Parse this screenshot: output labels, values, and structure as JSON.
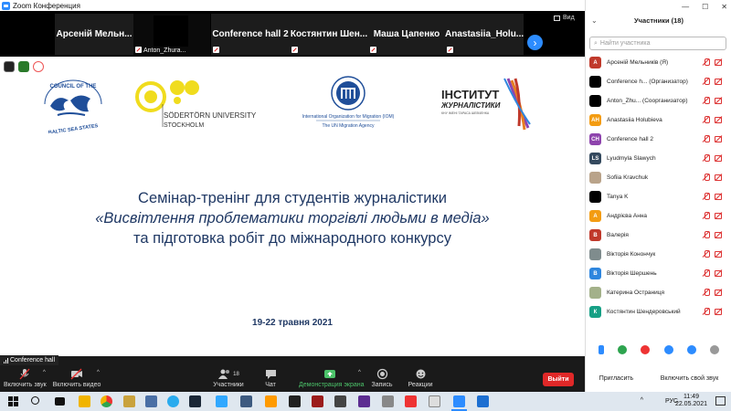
{
  "window": {
    "title": "Zoom Конференция"
  },
  "strip": {
    "tiles": [
      {
        "name": "Арсеній Мельн...",
        "type": "name"
      },
      {
        "name": "Anton_Zhura...",
        "type": "video"
      },
      {
        "name": "Conference hall 2",
        "type": "name"
      },
      {
        "name": "Костянтин Шен...",
        "type": "name"
      },
      {
        "name": "Маша Цапенко",
        "type": "name"
      },
      {
        "name": "Anastasiia_Holu...",
        "type": "name"
      }
    ],
    "view_label": "Вид"
  },
  "share": {
    "logos": {
      "cbss": "COUNCIL OF THE BALTIC SEA STATES",
      "sodertorn_line1": "SÖDERTÖRN UNIVERSITY",
      "sodertorn_line2": "STOCKHOLM",
      "iom_line1": "International Organization for Migration (IOM)",
      "iom_line2": "The UN Migration Agency",
      "inst_line1": "ІНСТИТУТ",
      "inst_line2": "ЖУРНАЛІСТИКИ",
      "inst_line3": "КНУ ІМЕНІ ТАРАСА ШЕВЧЕНКА"
    },
    "headline_line1": "Семінар-тренінг для студентів журналістики",
    "headline_line2": "«Висвітлення проблематики торгівлі людьми в медіа»",
    "headline_line3": "та підготовка робіт до міжнародного конкурсу",
    "dates": "19-22 травня 2021",
    "presenter_label": "Conference hall"
  },
  "toolbar": {
    "audio": "Включить звук",
    "video": "Включить видео",
    "participants": "Участники",
    "participants_count": "18",
    "chat": "Чат",
    "share": "Демонстрация экрана",
    "record": "Запись",
    "reactions": "Реакции",
    "leave": "Выйти"
  },
  "panel": {
    "title": "Участники (18)",
    "search_placeholder": "Найти участника",
    "participants": [
      {
        "initials": "А",
        "name": "Арсеній Мельників (Я)",
        "color": "#C0392B"
      },
      {
        "initials": "",
        "name": "Conference h... (Организатор)",
        "color": "#000000"
      },
      {
        "initials": "",
        "name": "Anton_Zhu... (Соорганизатор)",
        "color": "#000000"
      },
      {
        "initials": "AH",
        "name": "Anastasiia Holubieva",
        "color": "#F39C12"
      },
      {
        "initials": "CH",
        "name": "Conference hall 2",
        "color": "#8E44AD"
      },
      {
        "initials": "LS",
        "name": "Lyudmyla Slawych",
        "color": "#34495E"
      },
      {
        "initials": "",
        "name": "Sofiia Kravchuk",
        "color": "#B9A38A"
      },
      {
        "initials": "",
        "name": "Tanya K",
        "color": "#000000"
      },
      {
        "initials": "А",
        "name": "Андрієва Анна",
        "color": "#F39C12"
      },
      {
        "initials": "В",
        "name": "Валерія",
        "color": "#C0392B"
      },
      {
        "initials": "",
        "name": "Вікторія Конончук",
        "color": "#7F8C8D"
      },
      {
        "initials": "В",
        "name": "Вікторія Шершень",
        "color": "#2E86DE"
      },
      {
        "initials": "",
        "name": "Катерина Остраниця",
        "color": "#A3B18A"
      },
      {
        "initials": "К",
        "name": "Костянтин Шендеровський",
        "color": "#16A085"
      }
    ],
    "invite": "Пригласить",
    "unmute_me": "Включить свой звук"
  },
  "taskbar": {
    "time": "11:49",
    "date": "22.05.2021",
    "lang": "РУС"
  }
}
